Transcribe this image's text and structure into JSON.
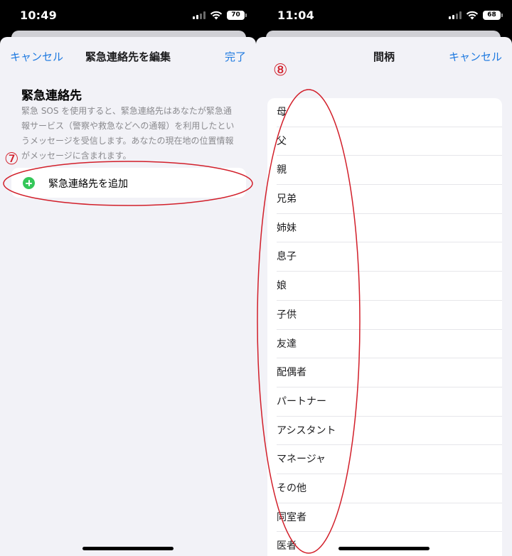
{
  "left_screen": {
    "status": {
      "time": "10:49",
      "battery": "70"
    },
    "nav": {
      "cancel": "キャンセル",
      "title": "緊急連絡先を編集",
      "done": "完了"
    },
    "section_title": "緊急連絡先",
    "description": "緊急 SOS を使用すると、緊急連絡先はあなたが緊急通報サービス（警察や救急などへの通報）を利用したというメッセージを受信します。あなたの現在地の位置情報がメッセージに含まれます。",
    "add_button": "緊急連絡先を追加",
    "annotation": "⑦"
  },
  "right_screen": {
    "status": {
      "time": "11:04",
      "battery": "68"
    },
    "nav": {
      "title": "間柄",
      "cancel": "キャンセル"
    },
    "relationships": [
      "母",
      "父",
      "親",
      "兄弟",
      "姉妹",
      "息子",
      "娘",
      "子供",
      "友達",
      "配偶者",
      "パートナー",
      "アシスタント",
      "マネージャ",
      "その他",
      "同室者",
      "医者"
    ],
    "annotation": "⑧"
  },
  "colors": {
    "accent": "#1f7ae0",
    "plus": "#34c759",
    "annotation": "#d21f2a",
    "background": "#f2f2f7"
  },
  "icons": [
    "signal-icon",
    "wifi-icon",
    "battery-icon",
    "plus-icon"
  ]
}
